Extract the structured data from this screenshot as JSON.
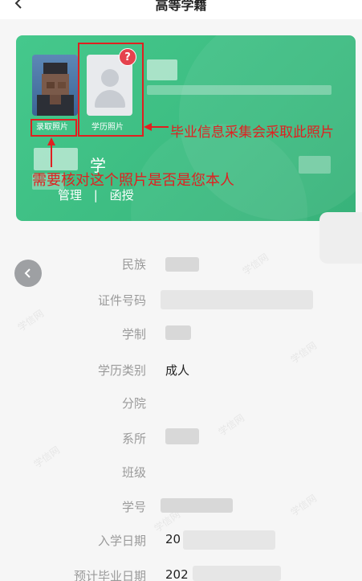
{
  "header": {
    "title": "高等学籍",
    "back_icon": "chevron-left-icon"
  },
  "card": {
    "photo1_label": "录取照片",
    "photo2_label": "学历照片",
    "badge": "?",
    "school_char": "学",
    "links": [
      "管理",
      "|",
      "函授"
    ],
    "accent_color": "#3dbd82"
  },
  "annotations": {
    "right_note": "毕业信息采集会采取此照片",
    "left_note": "需要核对这个照片是否是您本人",
    "color": "#e02020"
  },
  "fields": [
    {
      "label": "民族",
      "value": ""
    },
    {
      "label": "证件号码",
      "value": ""
    },
    {
      "label": "学制",
      "value": ""
    },
    {
      "label": "学历类别",
      "value": "成人"
    },
    {
      "label": "分院",
      "value": ""
    },
    {
      "label": "系所",
      "value": ""
    },
    {
      "label": "班级",
      "value": ""
    },
    {
      "label": "学号",
      "value": ""
    },
    {
      "label": "入学日期",
      "value": "20"
    },
    {
      "label": "预计毕业日期",
      "value": "202"
    }
  ],
  "watermark_text": "学信网"
}
